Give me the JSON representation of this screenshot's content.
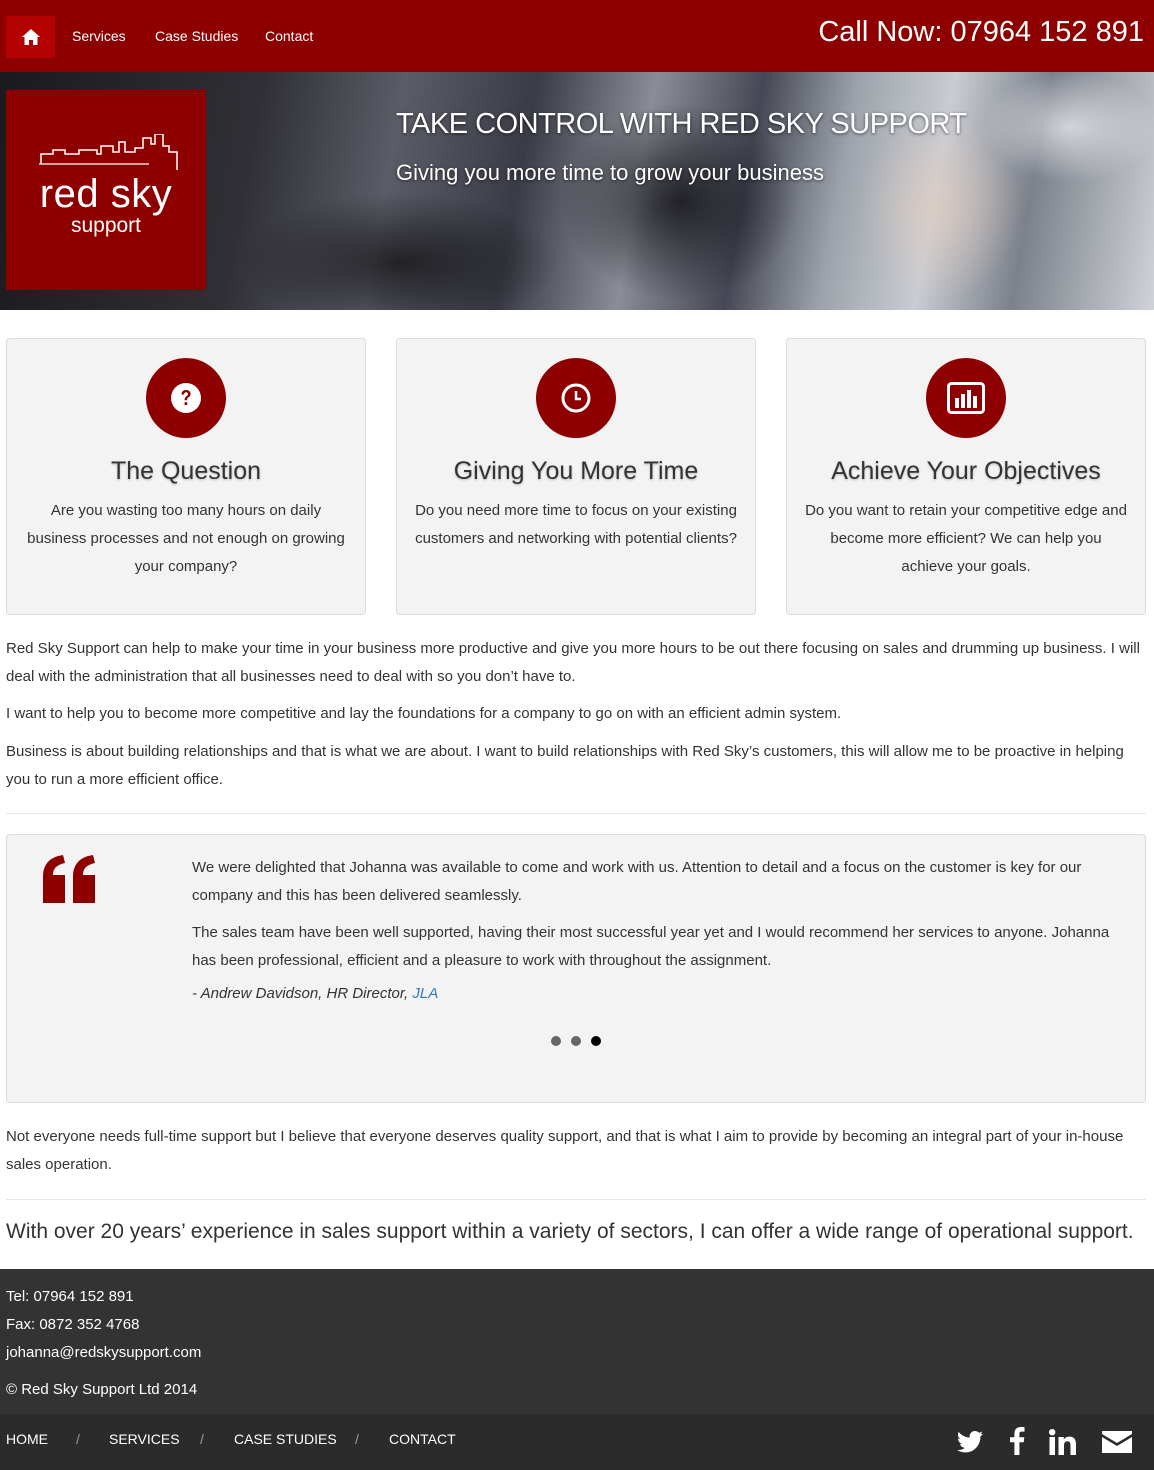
{
  "nav": {
    "home_icon": "home-icon",
    "links": [
      "Services",
      "Case Studies",
      "Contact"
    ],
    "call_label": "Call Now:",
    "call_number": "07964 152 891"
  },
  "hero": {
    "logo_main": "red sky",
    "logo_sub": "support",
    "title": "TAKE CONTROL WITH RED SKY SUPPORT",
    "subtitle": "Giving you more time to grow your business"
  },
  "features": [
    {
      "icon": "question-circle-icon",
      "title": "The Question",
      "text": "Are you wasting too many hours on daily business processes and not enough on growing your company?"
    },
    {
      "icon": "clock-icon",
      "title": "Giving You More Time",
      "text": "Do you need more time to focus on your existing customers and networking with potential clients?"
    },
    {
      "icon": "bar-chart-icon",
      "title": "Achieve Your Objectives",
      "text": "Do you want to retain your competitive edge and become more efficient? We can help you achieve your goals."
    }
  ],
  "body": {
    "p1": "Red Sky Support can help to make your time in your business more productive and give you more hours to be out there focusing on sales and drumming up business. I will deal with the administration that all businesses need to deal with so you don’t have to.",
    "p2": "I want to help you to become more competitive and lay the foundations for a company to go on with an efficient admin system.",
    "p3": "Business is about building relationships and that is what we are about. I want to build relationships with Red Sky’s customers, this will allow me to be proactive in helping you to run a more efficient office.",
    "p4": "Not everyone needs full-time support but I believe that everyone deserves quality support, and that is what I aim to provide by becoming an integral part of your in-house sales operation.",
    "lead": "With over 20 years’ experience in sales support within a variety of sectors, I can offer a wide range of operational support."
  },
  "testimonial": {
    "quote_icon": "quote-left-icon",
    "line1": "We were delighted that Johanna was available to come and work with us. Attention to detail and a focus on the customer is key for our company and this has been delivered seamlessly.",
    "line2": "The sales team have been well supported, having their most successful year yet and I would recommend her services to anyone. Johanna has been professional, efficient and a pleasure to work with throughout the assignment.",
    "author": "- Andrew Davidson, HR Director, ",
    "company": "JLA",
    "slide_count": 3,
    "active_slide": 3
  },
  "footer": {
    "tel": "Tel: 07964 152 891",
    "fax": "Fax: 0872 352 4768",
    "email": "johanna@redskysupport.com",
    "copyright": "© Red Sky Support Ltd 2014",
    "nav": [
      "HOME",
      "SERVICES",
      "CASE STUDIES",
      "CONTACT"
    ],
    "separator": "/",
    "social": [
      "twitter-icon",
      "facebook-icon",
      "linkedin-icon",
      "envelope-icon"
    ]
  }
}
